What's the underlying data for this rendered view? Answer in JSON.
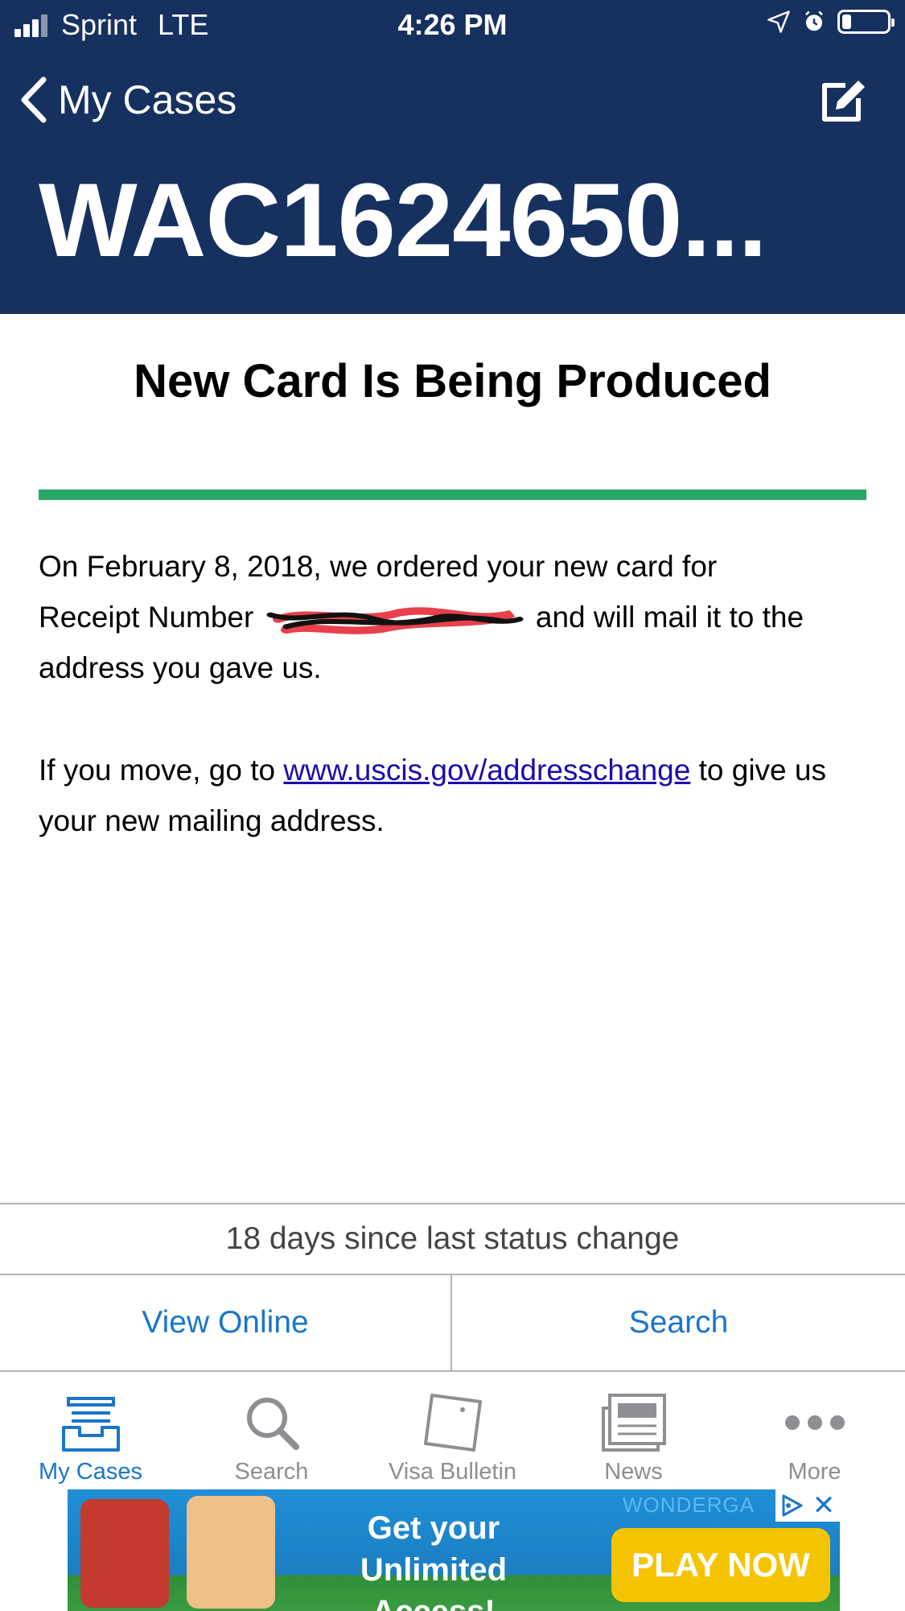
{
  "status_bar": {
    "carrier": "Sprint",
    "network": "LTE",
    "time": "4:26 PM",
    "battery_level": 0.2
  },
  "nav": {
    "back_label": "My Cases",
    "back_icon": "chevron-left-icon",
    "edit_icon": "compose-icon"
  },
  "case": {
    "receipt_number": "WAC1624650..."
  },
  "status": {
    "title": "New Card Is Being Produced",
    "progress": 1.0,
    "progress_color": "#28a866",
    "para1_line1": "On February 8, 2018, we ordered your new card for",
    "para1_pre": "Receipt Number",
    "para1_post": "and will mail it to the",
    "para1_line3": "address you gave us.",
    "para2_pre": "If you move, go to",
    "para2_link": "www.uscis.gov/addresschange",
    "para2_post": "to give us your new mailing address."
  },
  "days_since_change": "18 days since last status change",
  "actions": {
    "view_online": "View Online",
    "search": "Search"
  },
  "tabs": [
    {
      "label": "My Cases",
      "icon": "inbox-icon",
      "active": true
    },
    {
      "label": "Search",
      "icon": "search-icon",
      "active": false
    },
    {
      "label": "Visa Bulletin",
      "icon": "bulletin-icon",
      "active": false
    },
    {
      "label": "News",
      "icon": "news-icon",
      "active": false
    },
    {
      "label": "More",
      "icon": "more-icon",
      "active": false
    }
  ],
  "ad": {
    "headline_line1": "Get your",
    "headline_line2": "Unlimited Access!",
    "brand": "WONDERGA",
    "cta": "PLAY NOW"
  },
  "colors": {
    "header_bg": "#16315f",
    "accent": "#1a76c9",
    "link": "#1a0dab"
  }
}
